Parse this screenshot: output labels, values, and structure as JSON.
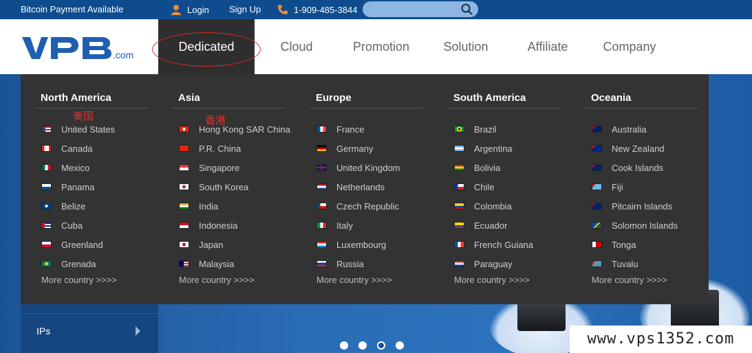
{
  "topbar": {
    "promo": "Bitcoin Payment Available",
    "login": "Login",
    "signup": "Sign Up",
    "phone": "1-909-485-3844",
    "search_placeholder": "",
    "icons": {
      "login": "user-icon",
      "phone": "phone-icon",
      "search": "search-icon"
    },
    "accent_color": "#f08a3c"
  },
  "logo": {
    "text": ".com",
    "brand": "VPB"
  },
  "nav": {
    "dedicated": "Dedicated Servers",
    "cloud": "Cloud",
    "promotion": "Promotion",
    "solution": "Solution",
    "affiliate": "Affiliate",
    "company": "Company"
  },
  "menu": {
    "columns": [
      {
        "title": "North America",
        "items": [
          "United States",
          "Canada",
          "Mexico",
          "Panama",
          "Belize",
          "Cuba",
          "Greenland",
          "Grenada"
        ],
        "more": "More country >>>>"
      },
      {
        "title": "Asia",
        "items": [
          "Hong Kong SAR China",
          "P.R. China",
          "Singapore",
          "South Korea",
          "India",
          "Indonesia",
          "Japan",
          "Malaysia"
        ],
        "more": "More country >>>>"
      },
      {
        "title": "Europe",
        "items": [
          "France",
          "Germany",
          "United Kingdom",
          "Netherlands",
          "Czech Republic",
          "Italy",
          "Luxembourg",
          "Russia"
        ],
        "more": "More country >>>>"
      },
      {
        "title": "South America",
        "items": [
          "Brazil",
          "Argentina",
          "Bolivia",
          "Chile",
          "Colombia",
          "Ecuador",
          "French Guiana",
          "Paraguay"
        ],
        "more": "More country >>>>"
      },
      {
        "title": "Oceania",
        "items": [
          "Australia",
          "New Zealand",
          "Cook Islands",
          "Fiji",
          "Pitcairn Islands",
          "Solomon Islands",
          "Tonga",
          "Tuvalu"
        ],
        "more": "More country >>>>"
      }
    ],
    "annotations": {
      "usa": "美国",
      "hk": "香港"
    }
  },
  "sidebar": {
    "ips": "IPs"
  },
  "carousel": {
    "count": 4,
    "active": 3
  },
  "watermark": "www.vps1352.com"
}
